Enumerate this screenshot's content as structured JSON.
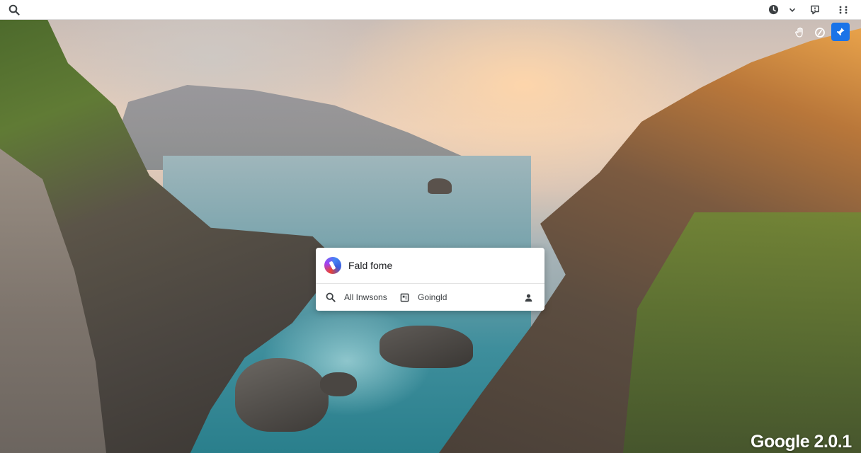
{
  "topbar": {
    "icons": {
      "search": "search-icon",
      "history": "clock-icon",
      "expand": "chevron-down-icon",
      "feedback": "feedback-icon",
      "apps": "apps-grid-icon"
    }
  },
  "corner_actions": {
    "icons": [
      "hand-icon",
      "circle-icon",
      "pin-icon"
    ],
    "active_color": "#1a73e8"
  },
  "card": {
    "title": "Fald fome",
    "row": {
      "all_label": "All Inwsons",
      "going_label": "Goingld"
    }
  },
  "watermark": {
    "text": "Google 2.0.1"
  },
  "colors": {
    "accent": "#1a73e8",
    "card_bg": "#ffffff",
    "text_dark": "#202124"
  }
}
